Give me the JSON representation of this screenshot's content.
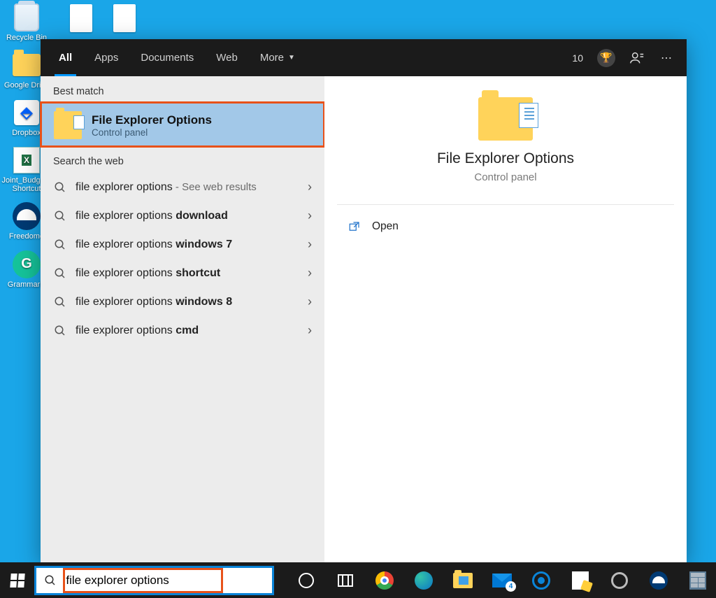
{
  "desktop": {
    "icons": [
      {
        "label": "Recycle Bin",
        "type": "trash"
      },
      {
        "label": "Google Drive",
        "type": "folder"
      },
      {
        "label": "Dropbox",
        "type": "dropbox"
      },
      {
        "label": "Joint_Budget - Shortcut",
        "type": "excel"
      },
      {
        "label": "Freedome",
        "type": "dome"
      },
      {
        "label": "Grammarly",
        "type": "grammarly"
      }
    ]
  },
  "search_panel": {
    "tabs": [
      "All",
      "Apps",
      "Documents",
      "Web",
      "More"
    ],
    "active_tab": "All",
    "points": "10",
    "sections": {
      "best_label": "Best match",
      "web_label": "Search the web"
    },
    "best_match": {
      "title": "File Explorer Options",
      "subtitle": "Control panel"
    },
    "web_results": [
      {
        "prefix": "file explorer options",
        "bold": "",
        "hint": " - See web results"
      },
      {
        "prefix": "file explorer options ",
        "bold": "download",
        "hint": ""
      },
      {
        "prefix": "file explorer options ",
        "bold": "windows 7",
        "hint": ""
      },
      {
        "prefix": "file explorer options ",
        "bold": "shortcut",
        "hint": ""
      },
      {
        "prefix": "file explorer options ",
        "bold": "windows 8",
        "hint": ""
      },
      {
        "prefix": "file explorer options ",
        "bold": "cmd",
        "hint": ""
      }
    ],
    "preview": {
      "title": "File Explorer Options",
      "subtitle": "Control panel",
      "actions": [
        {
          "label": "Open"
        }
      ]
    }
  },
  "taskbar": {
    "search_value": "file explorer options",
    "mail_badge": "4"
  }
}
